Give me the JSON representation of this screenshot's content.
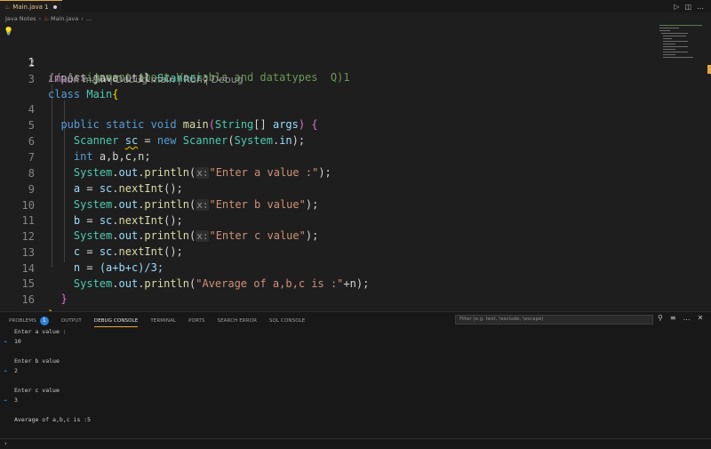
{
  "tab": {
    "title": "Main.java 1"
  },
  "tabbar_actions": {
    "run": "▷",
    "split": "◫",
    "more": "…"
  },
  "breadcrumb": {
    "folder": "Java Notes",
    "file": "Main.java",
    "more": "..."
  },
  "code_lens": {
    "items": [
      "Run main",
      "Debug main",
      "Run",
      "Debug"
    ]
  },
  "editor_lines": [
    {
      "num": "1"
    },
    {
      "num": "2"
    },
    {
      "num": "3"
    },
    {
      "num": "4"
    },
    {
      "num": "5"
    },
    {
      "num": "6"
    },
    {
      "num": "7"
    },
    {
      "num": "8"
    },
    {
      "num": "9"
    },
    {
      "num": "10"
    },
    {
      "num": "11"
    },
    {
      "num": "12"
    },
    {
      "num": "13"
    },
    {
      "num": "14"
    },
    {
      "num": "15"
    },
    {
      "num": "16"
    }
  ],
  "code": {
    "l1": "// Assignment about Variabls and datatypes  Q)1",
    "l2_kw": "import",
    "l2_rest": " java.util.",
    "l2_type": "Scanner",
    "l2_end": ";",
    "l3_kw": "class",
    "l3_type": "Main",
    "l3_br": "{",
    "l4_kw1": "public",
    "l4_kw2": "static",
    "l4_kw3": "void",
    "l4_fn": "main",
    "l4_br": "(",
    "l4_type": "String",
    "l4_arr": "[]",
    "l4_var": "args",
    "l4_br2": ")",
    "l4_br3": "{",
    "l5_type": "Scanner",
    "l5_var": "sc",
    "l5_eq": " = ",
    "l5_new": "new",
    "l5_type2": "Scanner",
    "l5_br": "(",
    "l5_type3": "System",
    "l5_dot": ".",
    "l5_var2": "in",
    "l5_end": ");",
    "l6_kw": "int",
    "l6_vars": " a,b,c,n;",
    "println_sys": "System",
    "println_out": "out",
    "println_fn": "println",
    "hint": "x:",
    "l7_str": "\"Enter a value :\"",
    "l8_var": "a",
    "nextint_sc": "sc",
    "nextint_fn": "nextInt",
    "l9_str": "\"Enter b value\"",
    "l10_var": "b",
    "l11_str": "\"Enter c value\"",
    "l12_var": "c",
    "l13_var": "n",
    "l13_expr": "(a+b+c)/3;",
    "l14_str": "\"Average of a,b,c is :\"",
    "l14_rest": "+n);",
    "l15_br": "}",
    "l16_br": "}"
  },
  "panel": {
    "tabs": [
      "PROBLEMS",
      "OUTPUT",
      "DEBUG CONSOLE",
      "TERMINAL",
      "PORTS",
      "SEARCH ERROR",
      "SQL CONSOLE"
    ],
    "problems_count": "1",
    "filter_placeholder": "Filter (e.g. text, !exclude, \\escape)",
    "actions": {
      "filter": "⚲",
      "menu": "≡",
      "more": "…",
      "close": "✕"
    }
  },
  "console": {
    "lines": [
      "Enter a value :",
      "10",
      "Enter b value",
      "2",
      "Enter c value",
      "3",
      "Average of a,b,c is :5"
    ],
    "input_arrow": "→",
    "prompt": "›"
  },
  "colors": {
    "accent": "#e5a842",
    "badge": "#2f7fd6",
    "keyword": "#569cd6",
    "string": "#ce9178",
    "type": "#4ec9b0",
    "function": "#dcdcaa",
    "variable": "#9cdcfe",
    "comment": "#6a9955"
  }
}
